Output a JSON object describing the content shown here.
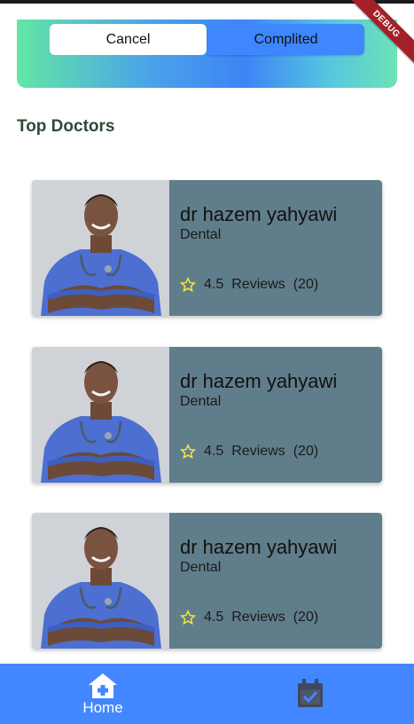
{
  "tabs": {
    "cancel_label": "Cancel",
    "completed_label": "Complited"
  },
  "debug_banner": "DEBUG",
  "section": {
    "title": "Top Doctors"
  },
  "doctors": [
    {
      "name": "dr hazem yahyawi",
      "specialty": "Dental",
      "rating": "4.5",
      "reviews_label": "Reviews",
      "reviews_count": "(20)"
    },
    {
      "name": "dr hazem yahyawi",
      "specialty": "Dental",
      "rating": "4.5",
      "reviews_label": "Reviews",
      "reviews_count": "(20)"
    },
    {
      "name": "dr hazem yahyawi",
      "specialty": "Dental",
      "rating": "4.5",
      "reviews_label": "Reviews",
      "reviews_count": "(20)"
    }
  ],
  "bottom_nav": {
    "home_label": "Home",
    "home_icon": "home-icon",
    "appointments_icon": "calendar-check-icon"
  },
  "colors": {
    "nav_background": "#4287ff",
    "card_info_background": "#607d8b",
    "completed_tab": "#3e87ff",
    "star": "#f5e63a"
  }
}
